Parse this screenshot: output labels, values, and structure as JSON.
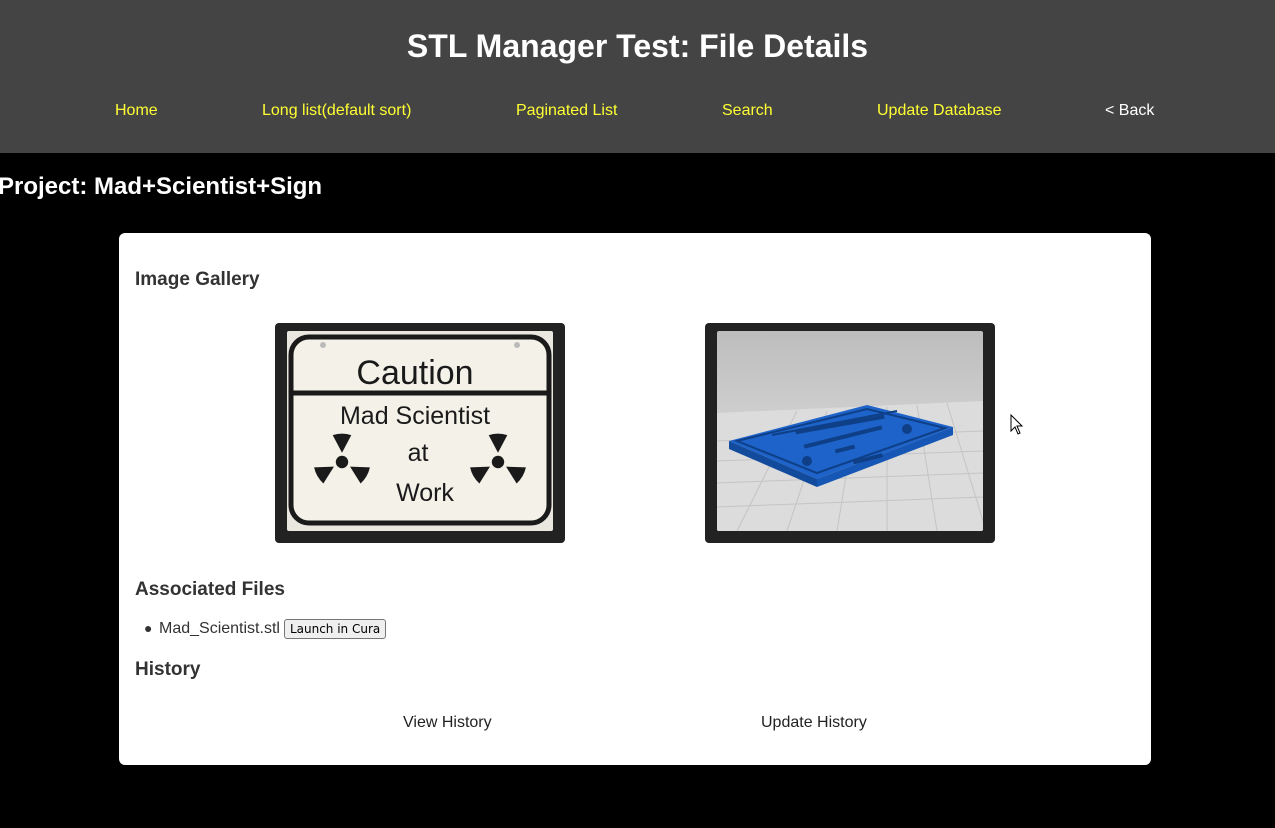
{
  "header": {
    "title": "STL Manager Test: File Details"
  },
  "nav": {
    "home": "Home",
    "long_list": "Long list(default sort)",
    "paginated": "Paginated List",
    "search": "Search",
    "update_db": "Update Database",
    "back": "< Back"
  },
  "project": {
    "title": "Project: Mad+Scientist+Sign"
  },
  "gallery": {
    "heading": "Image Gallery",
    "photo1": {
      "line1": "Caution",
      "line2": "Mad Scientist",
      "line3": "at",
      "line4": "Work"
    }
  },
  "files": {
    "heading": "Associated Files",
    "items": [
      {
        "name": "Mad_Scientist.stl",
        "button": "Launch in Cura"
      }
    ]
  },
  "history": {
    "heading": "History",
    "view": "View History",
    "update": "Update History"
  },
  "colors": {
    "header_bg": "#444444",
    "nav_link": "#ffff33",
    "page_bg": "#000000",
    "card_bg": "#ffffff",
    "model_blue": "#1f6fd1"
  }
}
